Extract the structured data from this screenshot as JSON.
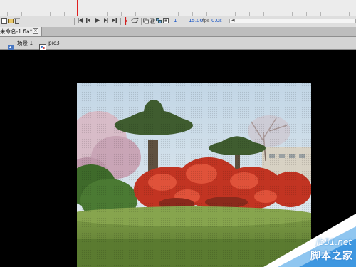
{
  "toolbar": {
    "frame_number": "1",
    "fps": "15.00",
    "fps_unit": "fps",
    "elapsed_time": "0.0s"
  },
  "document_tab": {
    "title": "未命名-1.fla*"
  },
  "breadcrumb": {
    "scene_label": "场景 1",
    "symbol_label": "pic3"
  },
  "watermark": {
    "site": "jb51.net",
    "name": "脚本之家"
  },
  "colors": {
    "playhead": "#e02020",
    "stage_background": "#000000",
    "accent_text": "#1a56c6"
  },
  "icons": [
    "play-icon",
    "rewind-icon",
    "step-back-icon",
    "step-forward-icon",
    "go-to-end-icon",
    "loop-icon",
    "onion-skin-icon",
    "edit-multiple-frames-icon",
    "close-icon",
    "scene-icon",
    "movie-clip-icon"
  ]
}
